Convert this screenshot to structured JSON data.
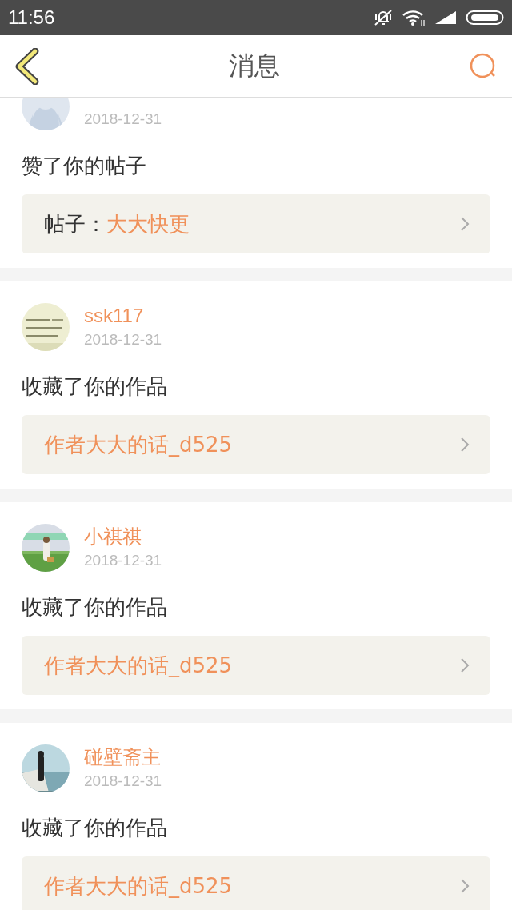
{
  "status_bar": {
    "time": "11:56"
  },
  "header": {
    "title": "消息"
  },
  "messages": [
    {
      "avatar": {
        "kind": "default"
      },
      "date": "2018-12-31",
      "action": "赞了你的帖子",
      "target": {
        "kind": "post",
        "label": "帖子：",
        "title": "大大快更"
      }
    },
    {
      "name": "ssk117",
      "date": "2018-12-31",
      "action": "收藏了你的作品",
      "target": {
        "kind": "work",
        "title": "作者大大的话_d525"
      }
    },
    {
      "name": "小祺祺",
      "date": "2018-12-31",
      "action": "收藏了你的作品",
      "target": {
        "kind": "work",
        "title": "作者大大的话_d525"
      }
    },
    {
      "name": "碰壁斋主",
      "date": "2018-12-31",
      "action": "收藏了你的作品",
      "target": {
        "kind": "work",
        "title": "作者大大的话_d525"
      }
    }
  ]
}
